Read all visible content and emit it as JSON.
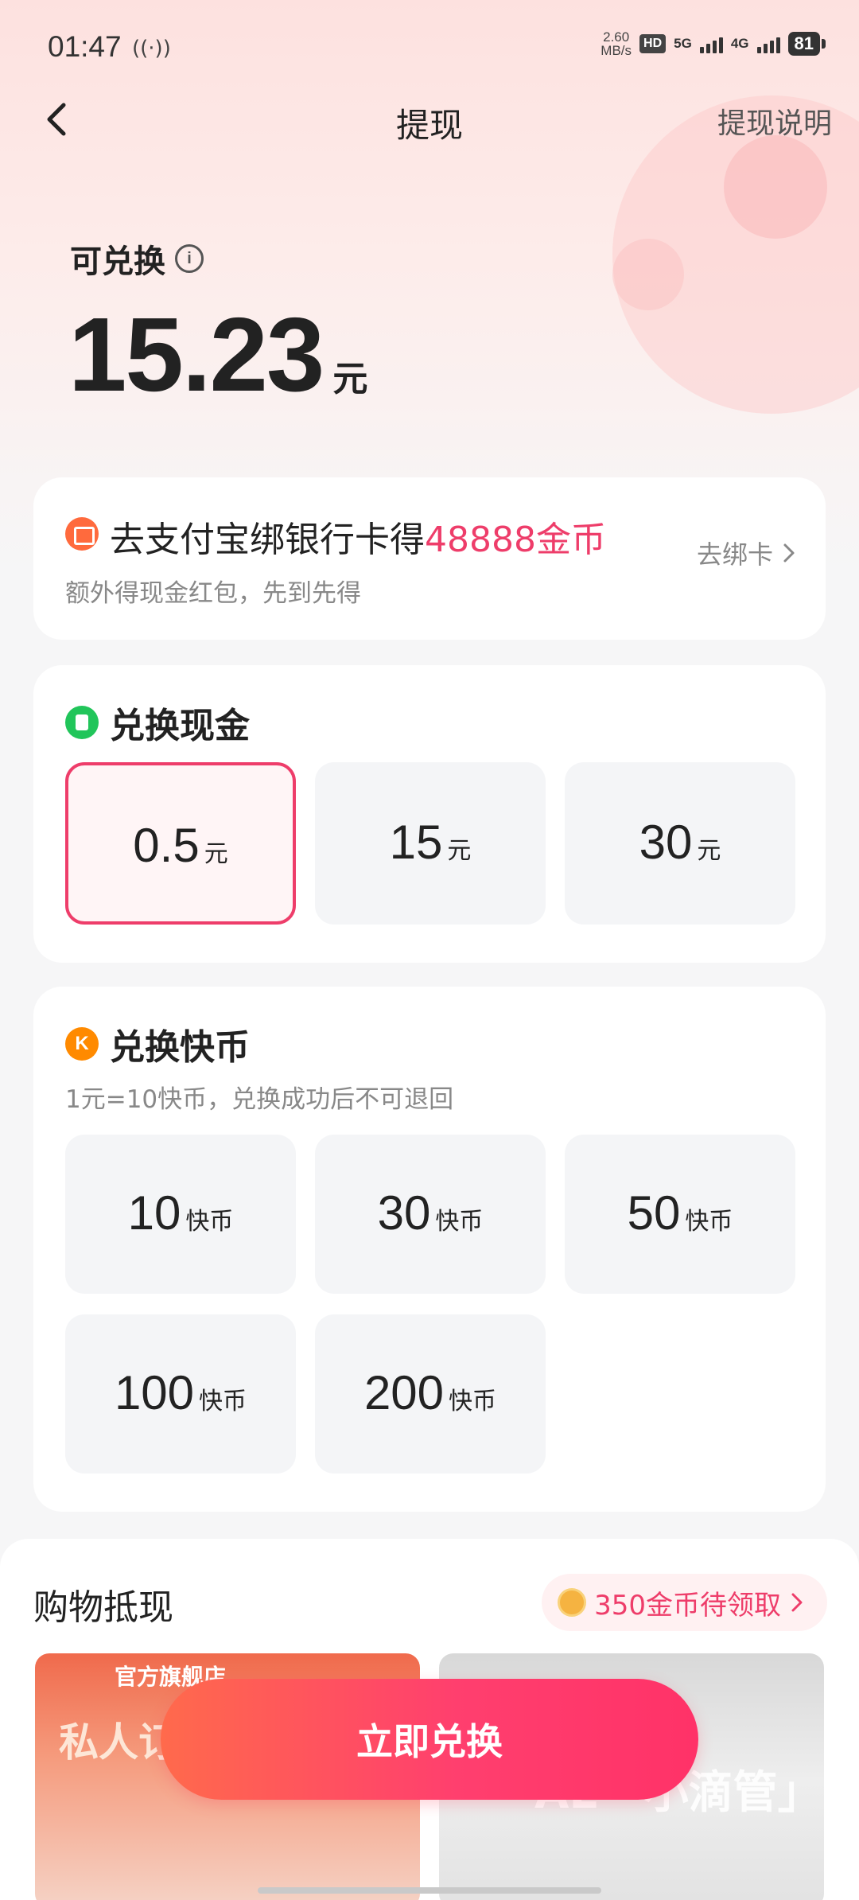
{
  "status_bar": {
    "time": "01:47",
    "hotspot_glyph": "((·))",
    "net_speed_value": "2.60",
    "net_speed_unit": "MB/s",
    "hd_badge": "HD",
    "net_5g": "5G",
    "net_4g": "4G",
    "battery": "81"
  },
  "nav": {
    "title": "提现",
    "help": "提现说明"
  },
  "balance": {
    "label": "可兑换",
    "amount": "15.23",
    "unit": "元"
  },
  "bind_card": {
    "headline_prefix": "去支付宝绑银行卡得",
    "headline_highlight": "48888金币",
    "subtitle": "额外得现金红包，先到先得",
    "action": "去绑卡",
    "accent_color": "#ee3d6a"
  },
  "cash": {
    "title": "兑换现金",
    "options": [
      {
        "value": "0.5",
        "unit": "元",
        "selected": true
      },
      {
        "value": "15",
        "unit": "元",
        "selected": false
      },
      {
        "value": "30",
        "unit": "元",
        "selected": false
      }
    ]
  },
  "kuaibi": {
    "title": "兑换快币",
    "icon_letter": "K",
    "note": "1元=10快币，兑换成功后不可退回",
    "options": [
      {
        "value": "10",
        "unit": "快币"
      },
      {
        "value": "30",
        "unit": "快币"
      },
      {
        "value": "50",
        "unit": "快币"
      },
      {
        "value": "100",
        "unit": "快币"
      },
      {
        "value": "200",
        "unit": "快币"
      }
    ]
  },
  "shopping": {
    "title": "购物抵现",
    "coins_label": "350金币待领取",
    "products": [
      {
        "store": "官方旗舰店",
        "promo": "私人订制 猛犬专用"
      },
      {
        "promo": "AE「小滴管」"
      }
    ]
  },
  "cta": {
    "label": "立即兑换",
    "color": "#ff3f6e"
  }
}
